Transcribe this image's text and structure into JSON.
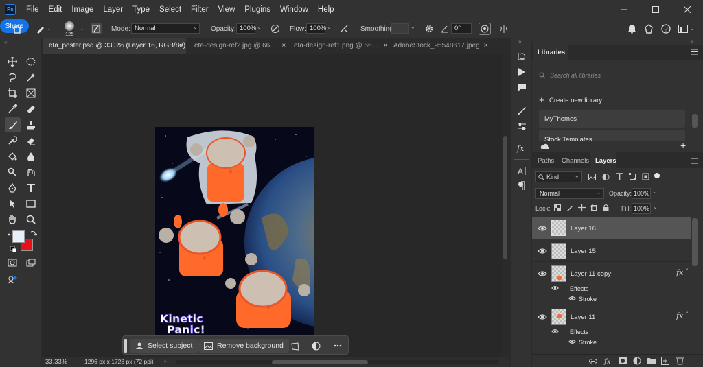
{
  "app": {
    "logo": "Ps"
  },
  "menu": [
    "File",
    "Edit",
    "Image",
    "Layer",
    "Type",
    "Select",
    "Filter",
    "View",
    "Plugins",
    "Window",
    "Help"
  ],
  "options": {
    "brush_size": "125",
    "mode_label": "Mode:",
    "mode_value": "Normal",
    "opacity_label": "Opacity:",
    "opacity_value": "100%",
    "flow_label": "Flow:",
    "flow_value": "100%",
    "smoothing_label": "Smoothing:",
    "smoothing_value": "",
    "angle_value": "0°",
    "share_label": "Share"
  },
  "tabs": [
    {
      "label": "eta_poster.psd @ 33.3% (Layer 16, RGB/8#) *",
      "active": true
    },
    {
      "label": "eta-design-ref2.jpg @ 66....",
      "active": false
    },
    {
      "label": "eta-design-ref1.png @ 66....",
      "active": false
    },
    {
      "label": "AdobeStock_95548617.jpeg",
      "active": false
    }
  ],
  "status": {
    "zoom": "33.33%",
    "info": "1296 px x 1728 px (72 ppi)"
  },
  "context_bar": {
    "select_subject": "Select subject",
    "remove_background": "Remove background"
  },
  "poster": {
    "title_line1": "Kinetic",
    "title_line2": "Panic!"
  },
  "libraries": {
    "tab": "Libraries",
    "search_placeholder": "Search all libraries",
    "create_label": "Create new library",
    "items": [
      "MyThemes",
      "Stock Templates"
    ]
  },
  "layers_panel": {
    "tabs": [
      "Paths",
      "Channels",
      "Layers"
    ],
    "active_tab": "Layers",
    "filter_kind": "Kind",
    "blend_mode": "Normal",
    "opacity_label": "Opacity:",
    "opacity_value": "100%",
    "lock_label": "Lock:",
    "fill_label": "Fill:",
    "fill_value": "100%",
    "layers": [
      {
        "name": "Layer 16",
        "selected": true
      },
      {
        "name": "Layer 15",
        "selected": false
      },
      {
        "name": "Layer 11 copy",
        "selected": false,
        "fx": "fx",
        "effects_label": "Effects",
        "effect": "Stroke"
      },
      {
        "name": "Layer 11",
        "selected": false,
        "fx": "fx",
        "effects_label": "Effects",
        "effect": "Stroke"
      }
    ]
  },
  "colors": {
    "foreground": "#e6f0fa",
    "background": "#e8101a",
    "accent": "#1473e6"
  }
}
